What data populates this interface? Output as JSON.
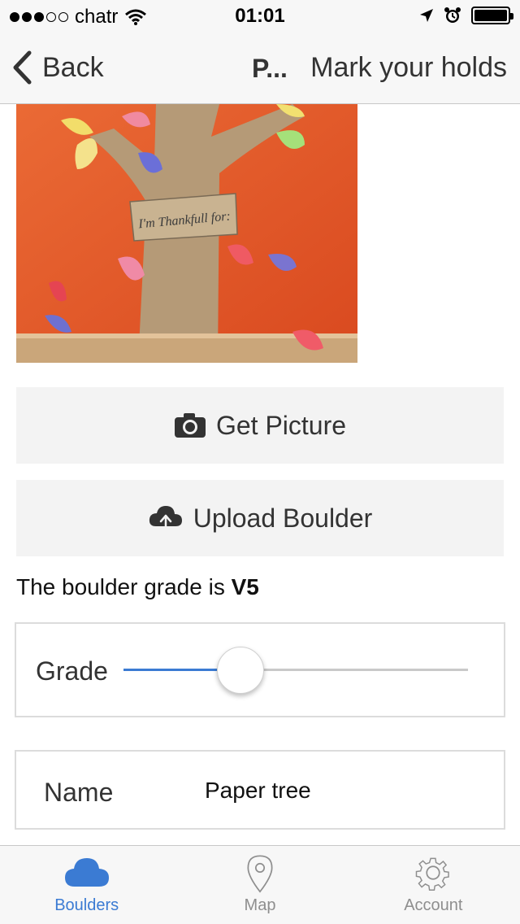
{
  "status_bar": {
    "carrier": "chatr",
    "time": "01:01",
    "signal_filled": 3,
    "signal_total": 5
  },
  "nav": {
    "back_label": "Back",
    "title": "P...",
    "action_label": "Mark your holds"
  },
  "photo": {
    "alt": "Paper tree on orange wall",
    "sign_text": "I'm Thankfull for:"
  },
  "buttons": {
    "get_picture": "Get Picture",
    "upload_boulder": "Upload Boulder"
  },
  "grade": {
    "prefix": "The boulder grade is",
    "value": "V5",
    "label": "Grade",
    "slider_fraction": 0.34
  },
  "name_field": {
    "label": "Name",
    "value": "Paper tree"
  },
  "tabs": [
    {
      "label": "Boulders",
      "icon": "cloud-icon",
      "active": true
    },
    {
      "label": "Map",
      "icon": "map-pin-icon",
      "active": false
    },
    {
      "label": "Account",
      "icon": "gear-icon",
      "active": false
    }
  ],
  "colors": {
    "accent": "#3b7bd3",
    "wall": "#e65a2b",
    "tab_inactive": "#8e8e8e"
  }
}
